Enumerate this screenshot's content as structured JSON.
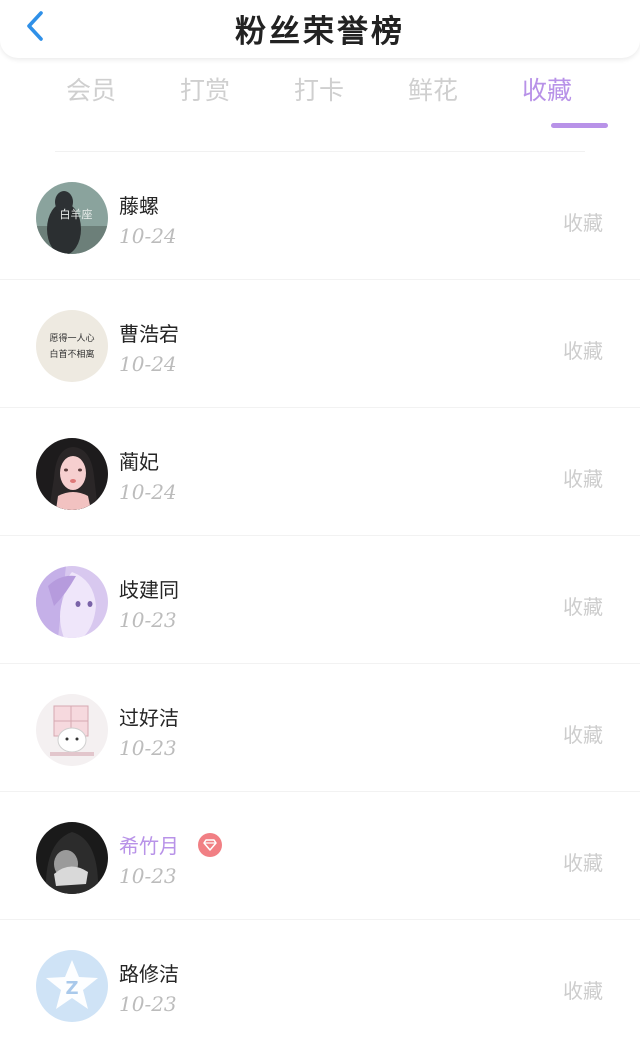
{
  "header": {
    "title": "粉丝荣誉榜"
  },
  "tabs": [
    {
      "label": "会员",
      "active": false
    },
    {
      "label": "打赏",
      "active": false
    },
    {
      "label": "打卡",
      "active": false
    },
    {
      "label": "鲜花",
      "active": false
    },
    {
      "label": "收藏",
      "active": true
    }
  ],
  "colors": {
    "accent": "#b892e8",
    "vip_badge": "#f17f84"
  },
  "fans": [
    {
      "name": "藤螺",
      "date": "10-24",
      "action": "收藏",
      "vip": false,
      "avatar_text": "白羊座"
    },
    {
      "name": "曹浩宕",
      "date": "10-24",
      "action": "收藏",
      "vip": false,
      "avatar_text": "愿得一人心 白首不相离"
    },
    {
      "name": "蔺妃",
      "date": "10-24",
      "action": "收藏",
      "vip": false
    },
    {
      "name": "歧建同",
      "date": "10-23",
      "action": "收藏",
      "vip": false
    },
    {
      "name": "过好洁",
      "date": "10-23",
      "action": "收藏",
      "vip": false
    },
    {
      "name": "希竹月",
      "date": "10-23",
      "action": "收藏",
      "vip": true,
      "badge_icon": "diamond-icon"
    },
    {
      "name": "路修洁",
      "date": "10-23",
      "action": "收藏",
      "vip": false,
      "avatar_text": "Z"
    }
  ]
}
